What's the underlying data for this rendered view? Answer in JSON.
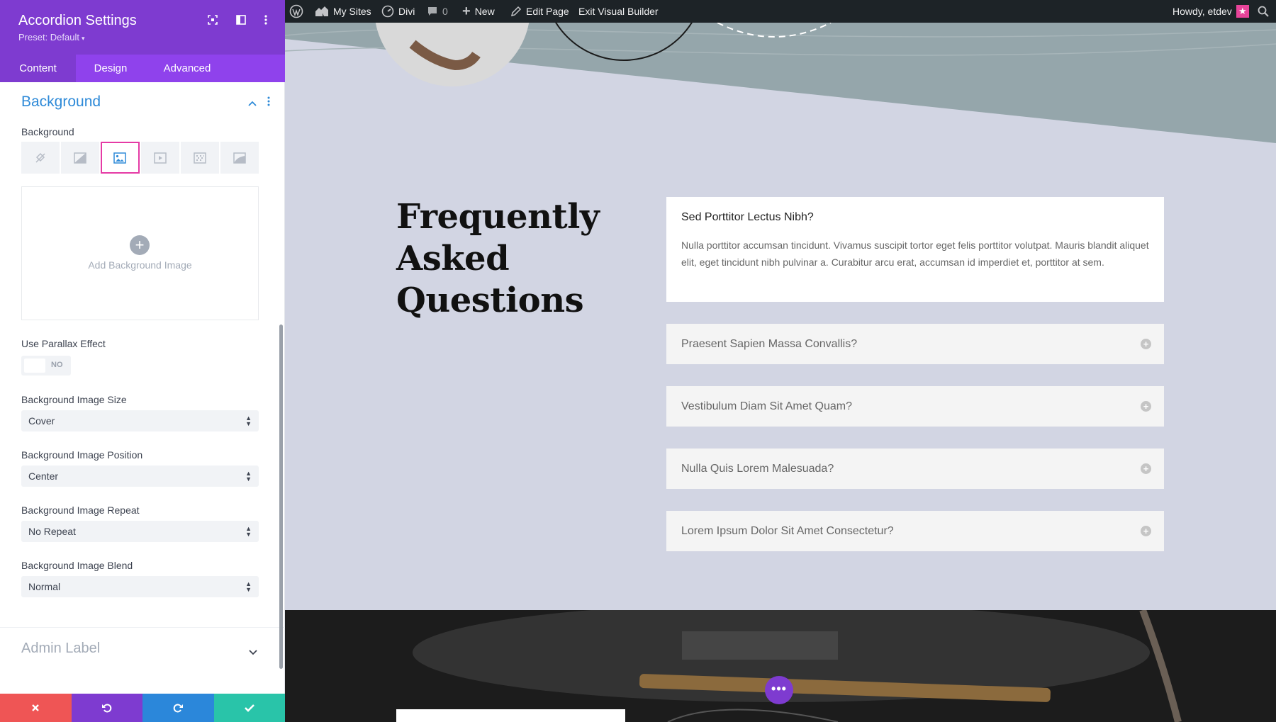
{
  "panel": {
    "title": "Accordion Settings",
    "preset": "Preset: Default",
    "tabs": [
      {
        "label": "Content",
        "active": true
      },
      {
        "label": "Design",
        "active": false
      },
      {
        "label": "Advanced",
        "active": false
      }
    ],
    "section_title": "Background",
    "background_label": "Background",
    "bg_types": [
      "color",
      "gradient",
      "image",
      "video",
      "pattern",
      "mask"
    ],
    "bg_selected": "image",
    "add_image_label": "Add Background Image",
    "parallax": {
      "label": "Use Parallax Effect",
      "value": "NO"
    },
    "fields": [
      {
        "label": "Background Image Size",
        "value": "Cover"
      },
      {
        "label": "Background Image Position",
        "value": "Center"
      },
      {
        "label": "Background Image Repeat",
        "value": "No Repeat"
      },
      {
        "label": "Background Image Blend",
        "value": "Normal"
      }
    ],
    "admin_label": "Admin Label",
    "footer_colors": {
      "discard": "#ef5555",
      "undo": "#7e3bd0",
      "redo": "#2b87da",
      "save": "#29c4a9"
    }
  },
  "adminbar": {
    "my_sites": "My Sites",
    "divi": "Divi",
    "comments": "0",
    "new": "New",
    "edit_page": "Edit Page",
    "exit_builder": "Exit Visual Builder",
    "howdy": "Howdy, etdev"
  },
  "page": {
    "faq_title": [
      "Frequently",
      "Asked",
      "Questions"
    ],
    "accordion": [
      {
        "question": "Sed Porttitor Lectus Nibh?",
        "open": true,
        "answer": "Nulla porttitor accumsan tincidunt. Vivamus suscipit tortor eget felis porttitor volutpat. Mauris blandit aliquet elit, eget tincidunt nibh pulvinar a. Curabitur arcu erat, accumsan id imperdiet et, porttitor at sem."
      },
      {
        "question": "Praesent Sapien Massa Convallis?",
        "open": false
      },
      {
        "question": "Vestibulum Diam Sit Amet Quam?",
        "open": false
      },
      {
        "question": "Nulla Quis Lorem Malesuada?",
        "open": false
      },
      {
        "question": "Lorem Ipsum Dolor Sit Amet Consectetur?",
        "open": false
      }
    ]
  }
}
